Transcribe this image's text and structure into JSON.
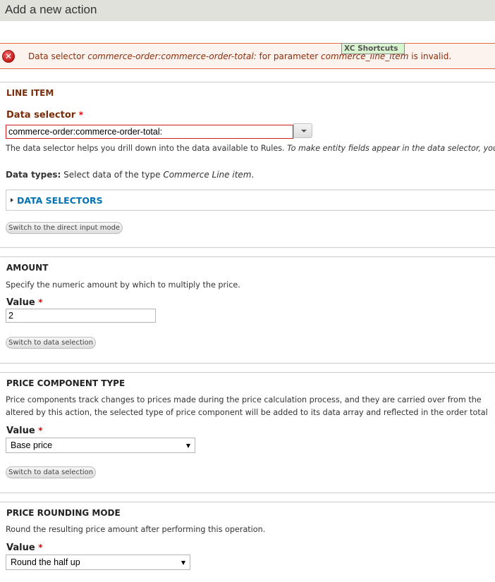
{
  "header": {
    "title": "Add a new action"
  },
  "error": {
    "icon": "error-icon",
    "prefix": "Data selector ",
    "selector": "commerce-order:commerce-order-total:",
    "middle": " for parameter ",
    "parameter": "commerce_line_item",
    "suffix": " is invalid."
  },
  "tooltip": {
    "label": "XC Shortcuts"
  },
  "line_item": {
    "title": "LINE ITEM",
    "label": "Data selector",
    "required_marker": "*",
    "input_value": "commerce-order:commerce-order-total:",
    "help_plain": "The data selector helps you drill down into the data available to Rules. ",
    "help_italic": "To make entity fields appear in the data selector, you may have",
    "data_types_label": "Data types:",
    "data_types_text": " Select data of the type ",
    "data_types_type": "Commerce Line item",
    "data_types_end": ".",
    "data_selectors_legend": "DATA SELECTORS",
    "switch_button": "Switch to the direct input mode"
  },
  "amount": {
    "title": "AMOUNT",
    "description": "Specify the numeric amount by which to multiply the price.",
    "label": "Value",
    "required_marker": "*",
    "input_value": "2",
    "switch_button": "Switch to data selection"
  },
  "price_component": {
    "title": "PRICE COMPONENT TYPE",
    "description_line1": "Price components track changes to prices made during the price calculation process, and they are carried over from the",
    "description_line2": "altered by this action, the selected type of price component will be added to its data array and reflected in the order total",
    "label": "Value",
    "required_marker": "*",
    "selected": "Base price",
    "switch_button": "Switch to data selection"
  },
  "rounding": {
    "title": "PRICE ROUNDING MODE",
    "description": "Round the resulting price amount after performing this operation.",
    "label": "Value",
    "required_marker": "*",
    "selected": "Round the half up"
  }
}
